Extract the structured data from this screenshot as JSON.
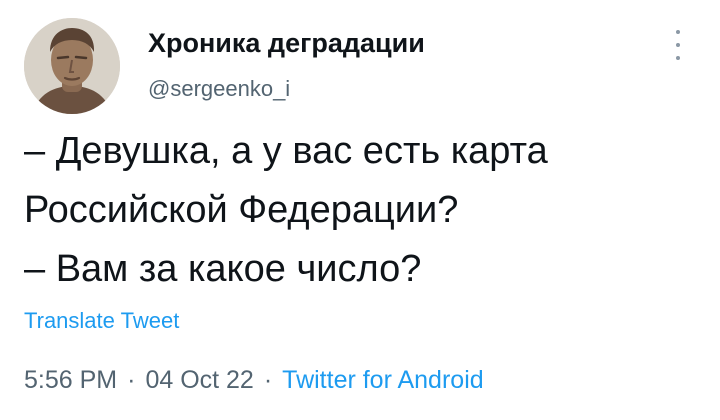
{
  "author": {
    "display_name": "Хроника деградации",
    "handle": "@sergeenko_i",
    "avatar_icon": "roman-bust-avatar"
  },
  "menu": {
    "icon": "more-vertical-icon"
  },
  "tweet": {
    "lines": [
      "– Девушка, а у вас есть карта",
      "Российской Федерации?",
      "– Вам за какое число?"
    ],
    "translate_label": "Translate Tweet"
  },
  "meta": {
    "time": "5:56 PM",
    "separator": "·",
    "date": "04 Oct 22",
    "source": "Twitter for Android"
  },
  "colors": {
    "text": "#0f1419",
    "secondary": "#536471",
    "link": "#1d9bf0"
  }
}
